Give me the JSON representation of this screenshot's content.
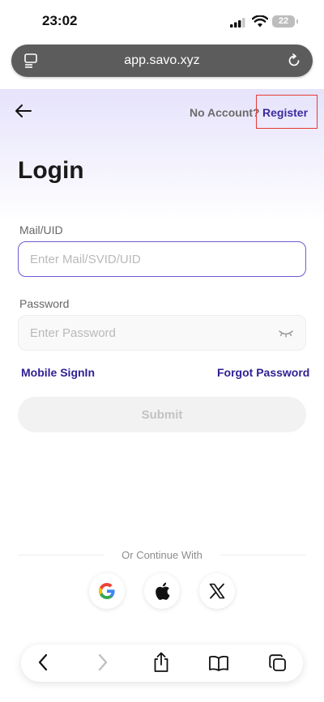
{
  "status_bar": {
    "time": "23:02",
    "battery": "22"
  },
  "browser": {
    "url": "app.savo.xyz"
  },
  "header": {
    "no_account_text": "No Account?",
    "register_label": "Register"
  },
  "page": {
    "title": "Login"
  },
  "form": {
    "mail_label": "Mail/UID",
    "mail_placeholder": "Enter Mail/SVID/UID",
    "mail_value": "",
    "password_label": "Password",
    "password_placeholder": "Enter Password",
    "password_value": "",
    "mobile_signin_label": "Mobile SignIn",
    "forgot_password_label": "Forgot Password",
    "submit_label": "Submit"
  },
  "social": {
    "divider_text": "Or Continue With",
    "providers": [
      "google-icon",
      "apple-icon",
      "x-icon"
    ]
  },
  "colors": {
    "accent": "#3b2aa0",
    "highlight_box": "#e53935",
    "focus_border": "#6c5bd4"
  }
}
